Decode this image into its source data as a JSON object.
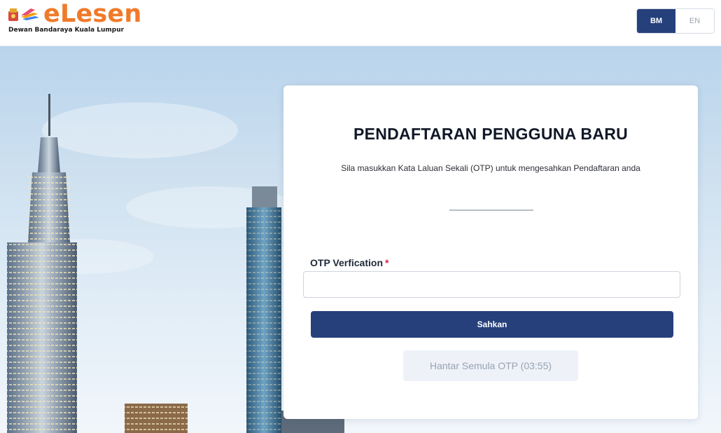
{
  "header": {
    "logo_text": "eLesen",
    "logo_subtitle": "Dewan Bandaraya Kuala Lumpur",
    "lang_bm": "BM",
    "lang_en": "EN"
  },
  "card": {
    "title": "PENDAFTARAN PENGGUNA BARU",
    "description": "Sila masukkan Kata Laluan Sekali (OTP) untuk mengesahkan Pendaftaran anda",
    "otp_label": "OTP Verfication",
    "required_mark": "*",
    "otp_value": "",
    "otp_placeholder": "",
    "submit_label": "Sahkan",
    "resend_label": "Hantar Semula OTP (03:55)"
  },
  "colors": {
    "primary": "#26407c",
    "logo_orange": "#ef7a2a",
    "required_red": "#e11d48"
  }
}
